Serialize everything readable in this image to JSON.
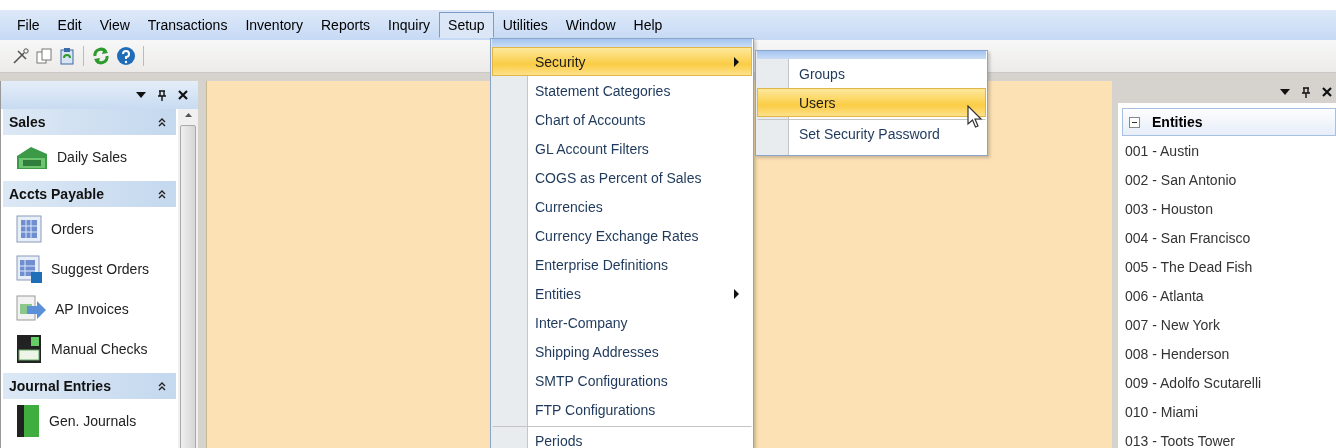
{
  "menu_bar": [
    {
      "label": "File",
      "selected": false
    },
    {
      "label": "Edit",
      "selected": false
    },
    {
      "label": "View",
      "selected": false
    },
    {
      "label": "Transactions",
      "selected": false
    },
    {
      "label": "Inventory",
      "selected": false
    },
    {
      "label": "Reports",
      "selected": false
    },
    {
      "label": "Inquiry",
      "selected": false
    },
    {
      "label": "Setup",
      "selected": true
    },
    {
      "label": "Utilities",
      "selected": false
    },
    {
      "label": "Window",
      "selected": false
    },
    {
      "label": "Help",
      "selected": false
    }
  ],
  "navigation_panel": {
    "sections": [
      {
        "title": "Sales",
        "expanded": true,
        "items": [
          {
            "label": "Daily Sales",
            "kind": "cash"
          }
        ]
      },
      {
        "title": "Accts Payable",
        "expanded": true,
        "items": [
          {
            "label": "Orders",
            "kind": "grid"
          },
          {
            "label": "Suggest Orders",
            "kind": "grid-help"
          },
          {
            "label": "AP Invoices",
            "kind": "invoice"
          },
          {
            "label": "Manual Checks",
            "kind": "check"
          }
        ]
      },
      {
        "title": "Journal Entries",
        "expanded": true,
        "items": [
          {
            "label": "Gen. Journals",
            "kind": "book"
          }
        ]
      }
    ]
  },
  "setup_menu": {
    "items": [
      {
        "label": "Security",
        "selected": true,
        "has_submenu": true,
        "separator_before": false
      },
      {
        "label": "Statement Categories",
        "selected": false,
        "has_submenu": false,
        "separator_before": false
      },
      {
        "label": "Chart of Accounts",
        "selected": false,
        "has_submenu": false,
        "separator_before": false
      },
      {
        "label": "GL Account Filters",
        "selected": false,
        "has_submenu": false,
        "separator_before": false
      },
      {
        "label": "COGS as Percent of Sales",
        "selected": false,
        "has_submenu": false,
        "separator_before": false
      },
      {
        "label": "Currencies",
        "selected": false,
        "has_submenu": false,
        "separator_before": false
      },
      {
        "label": "Currency Exchange Rates",
        "selected": false,
        "has_submenu": false,
        "separator_before": false
      },
      {
        "label": "Enterprise Definitions",
        "selected": false,
        "has_submenu": false,
        "separator_before": false
      },
      {
        "label": "Entities",
        "selected": false,
        "has_submenu": true,
        "separator_before": false
      },
      {
        "label": "Inter-Company",
        "selected": false,
        "has_submenu": false,
        "separator_before": false
      },
      {
        "label": "Shipping Addresses",
        "selected": false,
        "has_submenu": false,
        "separator_before": false
      },
      {
        "label": "SMTP Configurations",
        "selected": false,
        "has_submenu": false,
        "separator_before": false
      },
      {
        "label": "FTP Configurations",
        "selected": false,
        "has_submenu": false,
        "separator_before": false
      },
      {
        "label": "Periods",
        "selected": false,
        "has_submenu": false,
        "separator_before": true
      }
    ]
  },
  "security_submenu": {
    "items": [
      {
        "label": "Groups",
        "selected": false,
        "separator_before": false
      },
      {
        "label": "Users",
        "selected": true,
        "separator_before": false
      },
      {
        "label": "Set Security Password",
        "selected": false,
        "separator_before": true
      }
    ]
  },
  "entities_panel": {
    "title": "Entities",
    "expanded": true,
    "items": [
      "001 - Austin",
      "002 - San Antonio",
      "003 - Houston",
      "004 - San Francisco",
      "005 - The Dead Fish",
      "006 - Atlanta",
      "007 - New York",
      "008 - Henderson",
      "009 - Adolfo Scutarelli",
      "010 - Miami",
      "013 - Toots Tower"
    ]
  }
}
